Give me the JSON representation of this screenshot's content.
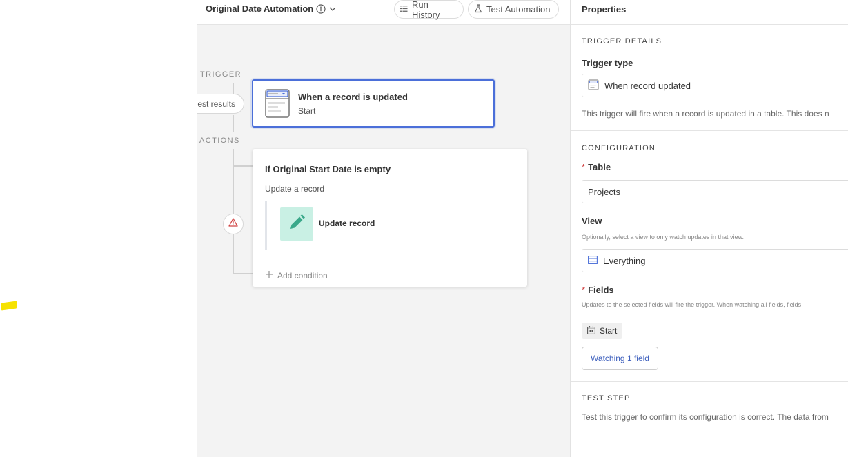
{
  "header": {
    "title": "Original Date Automation",
    "run_history_label": "Run History",
    "test_automation_label": "Test Automation"
  },
  "canvas": {
    "trigger_label": "TRIGGER",
    "actions_label": "ACTIONS",
    "test_results_label": "est results",
    "trigger_card": {
      "title": "When a record is updated",
      "subtitle": "Start"
    },
    "action_card": {
      "condition_title": "If Original Start Date is empty",
      "condition_subtitle": "Update a record",
      "action_label": "Update record",
      "add_condition_label": "Add condition"
    }
  },
  "panel": {
    "title": "Properties",
    "trigger_details": {
      "heading": "TRIGGER DETAILS",
      "trigger_type_label": "Trigger type",
      "trigger_type_value": "When record updated",
      "description": "This trigger will fire when a record is updated in a table. This does n"
    },
    "configuration": {
      "heading": "CONFIGURATION",
      "required_mark": "*",
      "table_label": "Table",
      "table_value": "Projects",
      "view_label": "View",
      "view_hint": "Optionally, select a view to only watch updates in that view.",
      "view_value": "Everything",
      "fields_label": "Fields",
      "fields_hint": "Updates to the selected fields will fire the trigger. When watching all fields, fields",
      "field_chip": "Start",
      "watching_button": "Watching 1 field"
    },
    "test_step": {
      "heading": "TEST STEP",
      "description": "Test this trigger to confirm its configuration is correct. The data from"
    }
  },
  "colors": {
    "accent_blue": "#4b6fd9",
    "link_blue": "#3d5fbd",
    "edit_tile_bg": "#c9f0e4",
    "edit_icon": "#3aa88a",
    "warning_red": "#d14343",
    "highlight_yellow": "#f6e200"
  },
  "icons": {
    "title_info": "info-icon",
    "title_dropdown": "chevron-down-icon",
    "run_history": "list-icon",
    "test_automation": "flask-icon",
    "trigger_card": "record-form-icon",
    "action": "pencil-icon",
    "warning": "warning-triangle-icon",
    "add_condition": "plus-icon",
    "trigger_type": "form-icon",
    "view": "grid-view-icon",
    "field_chip": "calendar-icon"
  }
}
